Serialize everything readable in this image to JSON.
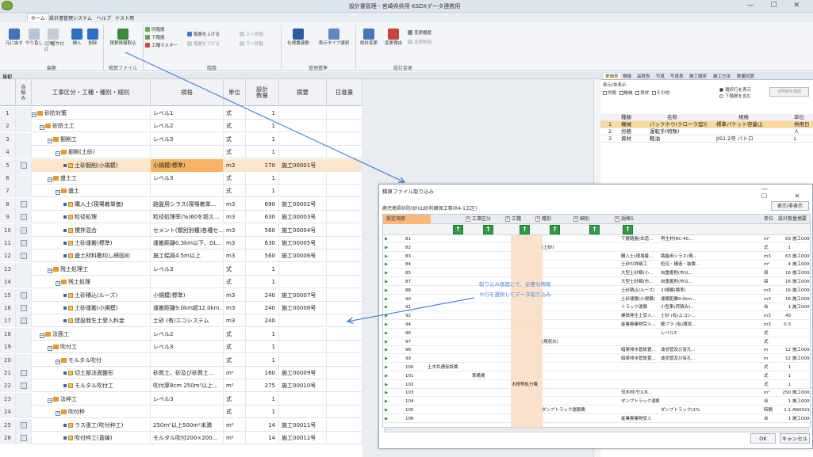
{
  "window": {
    "title": "設計書管理 - 宮崎県県用 KSDXデータ連携用",
    "controls": "— ☐ ✕"
  },
  "menu": [
    "ホーム",
    "設計書管理システム",
    "ヘルプ",
    "テスト用"
  ],
  "ribbon": {
    "buttons": [
      {
        "label": "元に戻す",
        "icon": "undo-icon"
      },
      {
        "label": "やり直し",
        "icon": "redo-icon"
      },
      {
        "label": "コピー",
        "icon": "copy-icon"
      },
      {
        "label": "貼り付け",
        "icon": "paste-icon"
      },
      {
        "label": "挿入",
        "icon": "insert-icon"
      },
      {
        "label": "削除",
        "icon": "delete-icon"
      },
      {
        "label": "積算情報取込",
        "icon": "import-icon"
      },
      {
        "label": "同階層",
        "icon": "same-level-icon"
      },
      {
        "label": "下階層",
        "icon": "lower-level-icon"
      },
      {
        "label": "工種マスター",
        "icon": "master-icon"
      },
      {
        "label": "階層を上げる",
        "icon": "level-up-icon"
      },
      {
        "label": "上へ移動",
        "icon": "move-up-icon"
      },
      {
        "label": "階層を下げる",
        "icon": "level-down-icon"
      },
      {
        "label": "下へ移動",
        "icon": "move-down-icon"
      },
      {
        "label": "仕様書連携",
        "icon": "spec-link-icon"
      },
      {
        "label": "表示タイプ選択",
        "icon": "view-type-icon"
      },
      {
        "label": "設計変更",
        "icon": "design-change-icon"
      },
      {
        "label": "変更理由",
        "icon": "change-reason-icon"
      },
      {
        "label": "変更履歴",
        "icon": "change-history-icon"
      },
      {
        "label": "変更削除",
        "icon": "change-delete-icon"
      }
    ],
    "groups": [
      "編集",
      "積算ファイル",
      "階層",
      "管理基準",
      "設計変更"
    ]
  },
  "main": {
    "panel_title": "当初",
    "columns": [
      "",
      "自積み",
      "工事区分・工種・種別・細別",
      "規格",
      "単位",
      "設計数量",
      "摘要",
      "日進量"
    ],
    "rows": [
      {
        "n": "1",
        "mark": false,
        "indent": 0,
        "type": "tree",
        "name": "砂防対策",
        "spec": "レベル1",
        "unit": "式",
        "qty": "1",
        "remark": ""
      },
      {
        "n": "2",
        "mark": false,
        "indent": 1,
        "type": "tree",
        "name": "砂防土工",
        "spec": "レベル2",
        "unit": "式",
        "qty": "1",
        "remark": ""
      },
      {
        "n": "3",
        "mark": false,
        "indent": 2,
        "type": "tree",
        "name": "掘削工",
        "spec": "レベル3",
        "unit": "式",
        "qty": "1",
        "remark": ""
      },
      {
        "n": "4",
        "mark": false,
        "indent": 3,
        "type": "tree",
        "name": "掘削(土砂)",
        "spec": "",
        "unit": "式",
        "qty": "1",
        "remark": ""
      },
      {
        "n": "5",
        "mark": true,
        "indent": 4,
        "type": "leaf",
        "name": "土砂掘削(小規模)",
        "spec": "小規模(標準)",
        "unit": "m3",
        "qty": "170",
        "remark": "施工00001号"
      },
      {
        "n": "6",
        "mark": false,
        "indent": 2,
        "type": "tree",
        "name": "盛土工",
        "spec": "レベル3",
        "unit": "式",
        "qty": "1",
        "remark": ""
      },
      {
        "n": "7",
        "mark": false,
        "indent": 3,
        "type": "tree",
        "name": "盛土",
        "spec": "",
        "unit": "式",
        "qty": "1",
        "remark": ""
      },
      {
        "n": "8",
        "mark": true,
        "indent": 4,
        "type": "leaf",
        "name": "購入土(現場着単価)",
        "spec": "路盤用シラス(現場着単...",
        "unit": "m3",
        "qty": "690",
        "remark": "施工00002号"
      },
      {
        "n": "9",
        "mark": true,
        "indent": 4,
        "type": "leaf",
        "name": "粒径処理",
        "spec": "粒径処理率(%)60を超え...",
        "unit": "m3",
        "qty": "630",
        "remark": "施工00003号"
      },
      {
        "n": "10",
        "mark": true,
        "indent": 4,
        "type": "leaf",
        "name": "攪拌混合",
        "spec": "セメント(類別別種)各種セ...",
        "unit": "m3",
        "qty": "560",
        "remark": "施工00004号"
      },
      {
        "n": "11",
        "mark": true,
        "indent": 4,
        "type": "leaf",
        "name": "土砂運搬(標準)",
        "spec": "運搬距離0.3km以下、DL...",
        "unit": "m3",
        "qty": "630",
        "remark": "施工00005号"
      },
      {
        "n": "12",
        "mark": true,
        "indent": 4,
        "type": "leaf",
        "name": "盛土材料敷均し締固め",
        "spec": "施工幅員4.5m以上",
        "unit": "m3",
        "qty": "560",
        "remark": "施工00006号"
      },
      {
        "n": "13",
        "mark": false,
        "indent": 2,
        "type": "tree",
        "name": "残土処理工",
        "spec": "レベル3",
        "unit": "式",
        "qty": "1",
        "remark": ""
      },
      {
        "n": "14",
        "mark": false,
        "indent": 3,
        "type": "tree",
        "name": "残土処理",
        "spec": "",
        "unit": "式",
        "qty": "1",
        "remark": ""
      },
      {
        "n": "15",
        "mark": true,
        "indent": 4,
        "type": "leaf",
        "name": "土砂積込(ルーズ)",
        "spec": "小規模(標準)",
        "unit": "m3",
        "qty": "240",
        "remark": "施工00007号"
      },
      {
        "n": "16",
        "mark": true,
        "indent": 4,
        "type": "leaf",
        "name": "土砂運搬(小規模)",
        "spec": "運搬距離9.0km超12.0km...",
        "unit": "m3",
        "qty": "240",
        "remark": "施工00008号"
      },
      {
        "n": "17",
        "mark": true,
        "indent": 4,
        "type": "leaf",
        "name": "建設発生土受入料金",
        "spec": "土砂 (有)エコシステム",
        "unit": "m3",
        "qty": "240",
        "remark": ""
      },
      {
        "n": "18",
        "mark": false,
        "indent": 1,
        "type": "tree",
        "name": "法面工",
        "spec": "レベル2",
        "unit": "式",
        "qty": "1",
        "remark": ""
      },
      {
        "n": "19",
        "mark": false,
        "indent": 2,
        "type": "tree",
        "name": "吹付工",
        "spec": "レベル3",
        "unit": "式",
        "qty": "1",
        "remark": ""
      },
      {
        "n": "20",
        "mark": false,
        "indent": 3,
        "type": "tree",
        "name": "モルタル吹付",
        "spec": "",
        "unit": "式",
        "qty": "1",
        "remark": ""
      },
      {
        "n": "21",
        "mark": true,
        "indent": 4,
        "type": "leaf",
        "name": "切土部法面整形",
        "spec": "砂質土、砂及び砂質土...",
        "unit": "m²",
        "qty": "160",
        "remark": "施工00009号"
      },
      {
        "n": "22",
        "mark": true,
        "indent": 4,
        "type": "leaf",
        "name": "モルタル吹付工",
        "spec": "吹付厚8cm 250m²以上...",
        "unit": "m²",
        "qty": "275",
        "remark": "施工00010号"
      },
      {
        "n": "23",
        "mark": false,
        "indent": 2,
        "type": "tree",
        "name": "法枠工",
        "spec": "レベル3",
        "unit": "式",
        "qty": "1",
        "remark": ""
      },
      {
        "n": "24",
        "mark": false,
        "indent": 3,
        "type": "tree",
        "name": "吹付枠",
        "spec": "",
        "unit": "式",
        "qty": "1",
        "remark": ""
      },
      {
        "n": "25",
        "mark": true,
        "indent": 4,
        "type": "leaf",
        "name": "ラス張工(吹付枠工)",
        "spec": "250m²以上500m²未満",
        "unit": "m²",
        "qty": "14",
        "remark": "施工00011号"
      },
      {
        "n": "26",
        "mark": true,
        "indent": 4,
        "type": "leaf",
        "name": "吹付枠工(直線)",
        "spec": "モルタル吹付200×200...",
        "unit": "m²",
        "qty": "14",
        "remark": "施工00012号"
      }
    ]
  },
  "right_panel": {
    "tabs": [
      "単価表",
      "規格",
      "品質表",
      "写真",
      "写真表",
      "施工順序",
      "施工方法",
      "数量試算"
    ],
    "display_label": "表示/非表示",
    "checks": [
      "労務",
      "機械",
      "資材",
      "その他"
    ],
    "radios": [
      "選択行を表示",
      "下階層を含む"
    ],
    "button": "全明細を展開",
    "headers": [
      "種類",
      "名称",
      "規格",
      "単位"
    ],
    "rows": [
      {
        "n": "1",
        "kind": "機械",
        "name": "バックホウ(クローラ型)[",
        "spec": "標準バケット容量山",
        "unit": "供用日"
      },
      {
        "n": "2",
        "kind": "労務",
        "name": "運転手(特殊)",
        "spec": "",
        "unit": "人"
      },
      {
        "n": "3",
        "kind": "資材",
        "name": "軽油",
        "spec": "JIS1.2号 パトロ",
        "unit": "L"
      }
    ]
  },
  "dialog": {
    "title": "積算ファイル取り込み",
    "controls": "— ☐ ✕",
    "path": "鹿児島県砂防(砂)山砂利確保工事(R4-1工区)",
    "display_button": "表示/非表示",
    "headers": [
      "設定項目",
      "工事区分",
      "工種",
      "種別",
      "細別",
      "規格5",
      "",
      "単位",
      "設計数量",
      "摘要"
    ],
    "rows": [
      {
        "id": "81",
        "c1": "",
        "c2": "",
        "c3": "",
        "c4": "",
        "c5": "下層路盤(本道...",
        "c6": "再生材(RC-40...",
        "unit": "m²",
        "qty": "",
        "remark": "施工00001号"
      },
      {
        "id": "82",
        "c1": "",
        "c2": "",
        "c3": "",
        "c4": "(土砂)",
        "c5": "",
        "c6": "",
        "unit": "式",
        "qty": "1",
        "remark": ""
      },
      {
        "id": "83",
        "c1": "",
        "c2": "",
        "c3": "",
        "c4": "",
        "c5": "購入土(現場着...",
        "c6": "路盤用シラス(現...",
        "unit": "m3",
        "qty": "",
        "remark": "施工00002号"
      },
      {
        "id": "84",
        "c1": "",
        "c2": "",
        "c3": "",
        "c4": "",
        "c5": "土砂の詳細工",
        "c6": "粒径・構造・装費...",
        "unit": "m²",
        "qty": "",
        "remark": "施工00003号"
      },
      {
        "id": "85",
        "c1": "",
        "c2": "",
        "c3": "",
        "c4": "",
        "c5": "大型土砂類(小...",
        "c6": "自重掘削(市以...",
        "unit": "袋",
        "qty": "",
        "remark": "施工00004号"
      },
      {
        "id": "87",
        "c1": "",
        "c2": "",
        "c3": "",
        "c4": "",
        "c5": "大型土砂類(市...",
        "c6": "自重掘削(市以...",
        "unit": "袋",
        "qty": "",
        "remark": "施工00005号"
      },
      {
        "id": "88",
        "c1": "",
        "c2": "",
        "c3": "",
        "c4": "",
        "c5": "土砂積込(ルーズ)",
        "c6": "小規模(標準)",
        "unit": "m3",
        "qty": "",
        "remark": "施工00006号"
      },
      {
        "id": "90",
        "c1": "",
        "c2": "",
        "c3": "",
        "c4": "",
        "c5": "土砂運搬(小規模)",
        "c6": "運搬距離9.0km...",
        "unit": "m3",
        "qty": "",
        "remark": "施工00007号"
      },
      {
        "id": "91",
        "c1": "",
        "c2": "",
        "c3": "",
        "c4": "",
        "c5": "トラック運搬",
        "c6": "小型車(荷積み)...",
        "unit": "台",
        "qty": "",
        "remark": "施工00014号"
      },
      {
        "id": "92",
        "c1": "",
        "c2": "",
        "c3": "",
        "c4": "",
        "c5": "建設発生土受入...",
        "c6": "土砂 (有)エコシ...",
        "unit": "m3",
        "qty": "",
        "remark": ""
      },
      {
        "id": "94",
        "c1": "",
        "c2": "",
        "c3": "",
        "c4": "",
        "c5": "産業廃棄物受入...",
        "c6": "廃プラ (有)環境...",
        "unit": "m3",
        "qty": "",
        "remark": ""
      },
      {
        "id": "96",
        "c1": "",
        "c2": "",
        "c3": "",
        "c4": "",
        "c5": "",
        "c6": "レベル3",
        "unit": "式",
        "qty": "1",
        "remark": ""
      },
      {
        "id": "97",
        "c1": "",
        "c2": "",
        "c3": "",
        "c4": "(現状水)",
        "c5": "",
        "c6": "",
        "unit": "式",
        "qty": "1",
        "remark": ""
      },
      {
        "id": "98",
        "c1": "",
        "c2": "",
        "c3": "",
        "c4": "",
        "c5": "暗渠排水管設置...",
        "c6": "波状管及び有孔...",
        "unit": "m",
        "qty": "",
        "remark": "施工00042号"
      },
      {
        "id": "99",
        "c1": "",
        "c2": "",
        "c3": "",
        "c4": "",
        "c5": "暗渠排水管設置...",
        "c6": "波状管及び有孔...",
        "unit": "m",
        "qty": "",
        "remark": "施工00043号"
      },
      {
        "id": "100",
        "c1": "土木共通仮設費",
        "c2": "",
        "c3": "",
        "c4": "",
        "c5": "",
        "c6": "",
        "unit": "式",
        "qty": "1",
        "remark": ""
      },
      {
        "id": "101",
        "c1": "",
        "c2": "準備費",
        "c3": "",
        "c4": "",
        "c5": "",
        "c6": "",
        "unit": "式",
        "qty": "1",
        "remark": ""
      },
      {
        "id": "102",
        "c1": "",
        "c2": "",
        "c3": "木根等処分費",
        "c4": "",
        "c5": "",
        "c6": "",
        "unit": "式",
        "qty": "1",
        "remark": ""
      },
      {
        "id": "103",
        "c1": "",
        "c2": "",
        "c3": "",
        "c4": "",
        "c5": "伐木材(竹)(木...",
        "c6": "",
        "unit": "m²",
        "qty": "",
        "remark": "施工00044号"
      },
      {
        "id": "104",
        "c1": "",
        "c2": "",
        "c3": "",
        "c4": "",
        "c5": "ダンプトラック運搬(",
        "c6": "",
        "unit": "台",
        "qty": "",
        "remark": "施工00045号"
      },
      {
        "id": "105",
        "c1": "",
        "c2": "",
        "c3": "",
        "c4": "ダンプトラック運搬費",
        "c5": "",
        "c6": "ダンプトラック(1%...",
        "unit": "時間",
        "qty": "",
        "remark": "AN0021"
      },
      {
        "id": "106",
        "c1": "",
        "c2": "",
        "c3": "",
        "c4": "",
        "c5": "産業廃棄物受入",
        "c6": "",
        "unit": "台",
        "qty": "",
        "remark": "施工00047号"
      }
    ],
    "qty_col": [
      "63",
      "1",
      "63",
      "4",
      "16",
      "16",
      "16",
      "16",
      "1",
      "40",
      "0.3",
      "",
      "",
      "12",
      "12",
      "1",
      "1",
      "1",
      "250",
      "1",
      "1.1",
      "1"
    ],
    "ok": "OK",
    "cancel": "キャンセル",
    "annotation_line1": "取り込み画面にて、必要な情報",
    "annotation_line2": "や行を選択してデータ取り込み"
  }
}
